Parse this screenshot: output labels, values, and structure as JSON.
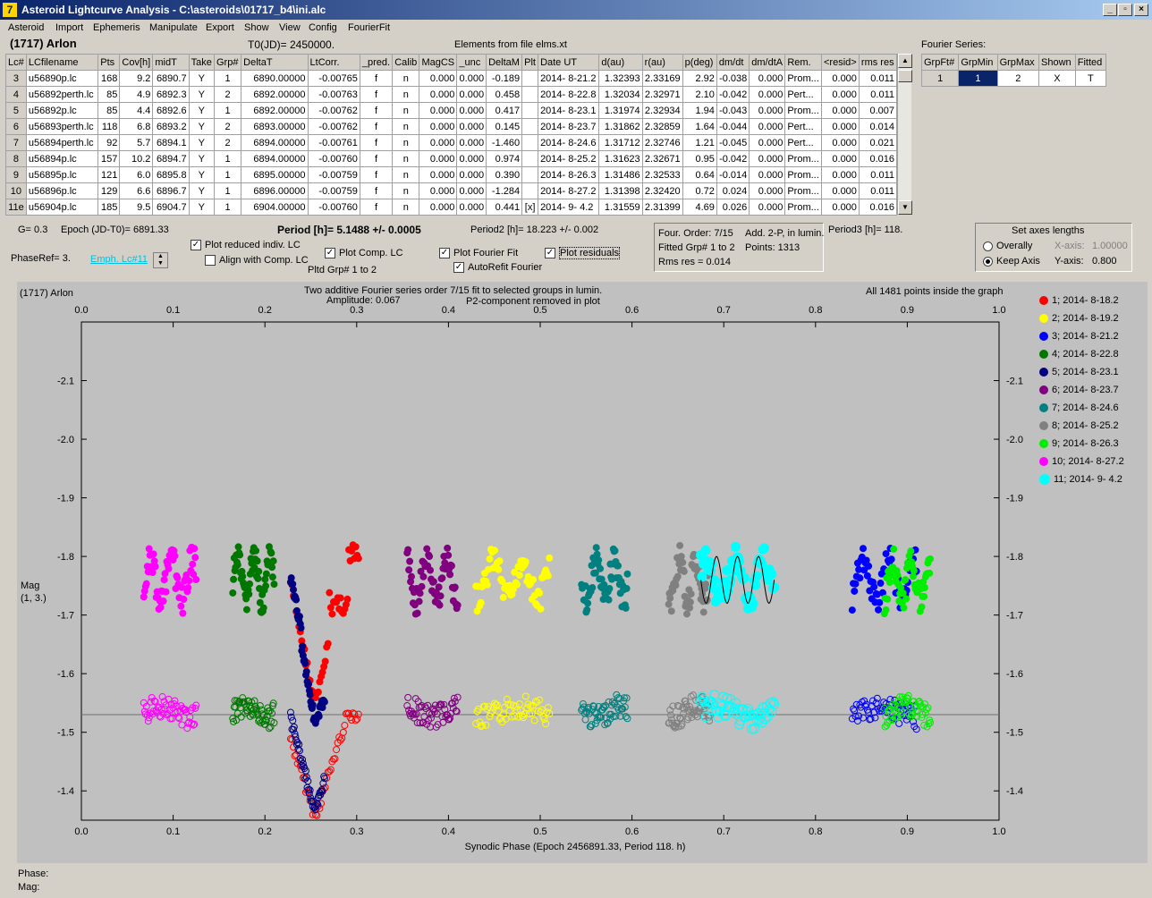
{
  "window": {
    "title": "Asteroid Lightcurve Analysis - C:\\asteroids\\01717_b4\\ini.alc",
    "app_icon_glyph": "7"
  },
  "menu": [
    "Asteroid",
    "Import",
    "Ephemeris",
    "Manipulate",
    "Export",
    "Show",
    "View",
    "Config",
    "FourierFit"
  ],
  "header": {
    "asteroid": "(1717) Arlon",
    "t0": "T0(JD)= 2450000.",
    "elements": "Elements from file elms.xt"
  },
  "table": {
    "columns": [
      "Lc#",
      "LCfilename",
      "Pts",
      "Cov[h]",
      "midT",
      "Take",
      "Grp#",
      "DeltaT",
      "LtCorr.",
      "_pred.",
      "Calib",
      "MagCS",
      "_unc",
      "DeltaM",
      "Plt",
      "Date UT",
      "d(au)",
      "r(au)",
      "p(deg)",
      "dm/dt",
      "dm/dtA",
      "Rem.",
      "<resid>",
      "rms res"
    ],
    "rows": [
      [
        "3",
        "u56890p.lc",
        "168",
        "9.2",
        "6890.7",
        "Y",
        "1",
        "6890.00000",
        "-0.00765",
        "f",
        "n",
        "0.000",
        "0.000",
        "-0.189",
        "",
        "2014- 8-21.2",
        "1.32393",
        "2.33169",
        "2.92",
        "-0.038",
        "0.000",
        "Prom...",
        "0.000",
        "0.011"
      ],
      [
        "4",
        "u56892perth.lc",
        "85",
        "4.9",
        "6892.3",
        "Y",
        "2",
        "6892.00000",
        "-0.00763",
        "f",
        "n",
        "0.000",
        "0.000",
        "0.458",
        "",
        "2014- 8-22.8",
        "1.32034",
        "2.32971",
        "2.10",
        "-0.042",
        "0.000",
        "Pert...",
        "0.000",
        "0.011"
      ],
      [
        "5",
        "u56892p.lc",
        "85",
        "4.4",
        "6892.6",
        "Y",
        "1",
        "6892.00000",
        "-0.00762",
        "f",
        "n",
        "0.000",
        "0.000",
        "0.417",
        "",
        "2014- 8-23.1",
        "1.31974",
        "2.32934",
        "1.94",
        "-0.043",
        "0.000",
        "Prom...",
        "0.000",
        "0.007"
      ],
      [
        "6",
        "u56893perth.lc",
        "118",
        "6.8",
        "6893.2",
        "Y",
        "2",
        "6893.00000",
        "-0.00762",
        "f",
        "n",
        "0.000",
        "0.000",
        "0.145",
        "",
        "2014- 8-23.7",
        "1.31862",
        "2.32859",
        "1.64",
        "-0.044",
        "0.000",
        "Pert...",
        "0.000",
        "0.014"
      ],
      [
        "7",
        "u56894perth.lc",
        "92",
        "5.7",
        "6894.1",
        "Y",
        "2",
        "6894.00000",
        "-0.00761",
        "f",
        "n",
        "0.000",
        "0.000",
        "-1.460",
        "",
        "2014- 8-24.6",
        "1.31712",
        "2.32746",
        "1.21",
        "-0.045",
        "0.000",
        "Pert...",
        "0.000",
        "0.021"
      ],
      [
        "8",
        "u56894p.lc",
        "157",
        "10.2",
        "6894.7",
        "Y",
        "1",
        "6894.00000",
        "-0.00760",
        "f",
        "n",
        "0.000",
        "0.000",
        "0.974",
        "",
        "2014- 8-25.2",
        "1.31623",
        "2.32671",
        "0.95",
        "-0.042",
        "0.000",
        "Prom...",
        "0.000",
        "0.016"
      ],
      [
        "9",
        "u56895p.lc",
        "121",
        "6.0",
        "6895.8",
        "Y",
        "1",
        "6895.00000",
        "-0.00759",
        "f",
        "n",
        "0.000",
        "0.000",
        "0.390",
        "",
        "2014- 8-26.3",
        "1.31486",
        "2.32533",
        "0.64",
        "-0.014",
        "0.000",
        "Prom...",
        "0.000",
        "0.011"
      ],
      [
        "10",
        "u56896p.lc",
        "129",
        "6.6",
        "6896.7",
        "Y",
        "1",
        "6896.00000",
        "-0.00759",
        "f",
        "n",
        "0.000",
        "0.000",
        "-1.284",
        "",
        "2014- 8-27.2",
        "1.31398",
        "2.32420",
        "0.72",
        "0.024",
        "0.000",
        "Prom...",
        "0.000",
        "0.011"
      ],
      [
        "11e",
        "u56904p.lc",
        "185",
        "9.5",
        "6904.7",
        "Y",
        "1",
        "6904.00000",
        "-0.00760",
        "f",
        "n",
        "0.000",
        "0.000",
        "0.441",
        "[x]",
        "2014- 9- 4.2",
        "1.31559",
        "2.31399",
        "4.69",
        "0.026",
        "0.000",
        "Prom...",
        "0.000",
        "0.016"
      ]
    ]
  },
  "fourier_series": {
    "label": "Fourier Series:",
    "columns": [
      "GrpFt#",
      "GrpMin",
      "GrpMax",
      "Shown",
      "Fitted"
    ],
    "row": [
      "1",
      "1",
      "2",
      "X",
      "T"
    ]
  },
  "info": {
    "g": "G= 0.3",
    "epoch": "Epoch (JD-T0)= 6891.33",
    "period": "Period [h]= 5.1488 +/- 0.0005",
    "period2": "Period2 [h]= 18.223 +/- 0.002",
    "period3": "Period3 [h]= 118.",
    "phaseref": "PhaseRef= 3.",
    "emph": "Emph. Lc#11",
    "fourier_box": [
      "Four. Order:  7/15",
      "Add. 2-P, in lumin.",
      "Fitted Grp# 1 to 2",
      "Points: 1313",
      "Rms res     = 0.014"
    ]
  },
  "checkboxes": {
    "plot_reduced": {
      "label": "Plot reduced indiv. LC",
      "checked": true
    },
    "align": {
      "label": "Align with Comp. LC",
      "checked": false
    },
    "plot_comp": {
      "label": "Plot Comp. LC",
      "checked": true
    },
    "plot_fourier": {
      "label": "Plot Fourier Fit",
      "checked": true
    },
    "autorefit": {
      "label": "AutoRefit Fourier",
      "checked": true
    },
    "plot_residuals": {
      "label": "Plot residuals",
      "checked": true
    }
  },
  "pltd_grp": "Pltd Grp#  1   to   2",
  "axes_panel": {
    "title": "Set axes lengths",
    "overall": "Overally",
    "keep": "Keep Axis",
    "xaxis_label": "X-axis:",
    "xaxis_value": "1.00000",
    "yaxis_label": "Y-axis:",
    "yaxis_value": "0.800"
  },
  "status": {
    "phase": "Phase:",
    "mag": "Mag:"
  },
  "chart_data": {
    "type": "scatter",
    "header_left": "(1717) Arlon",
    "header_center": [
      "Two additive Fourier series order 7/15 fit to selected groups in lumin.",
      "Amplitude: 0.067",
      "P2-component removed in plot"
    ],
    "header_right": "All 1481 points inside the graph",
    "xlabel": "Synodic Phase (Epoch 2456891.33, Period 118. h)",
    "ylabel": [
      "Mag",
      "(1, 3.)"
    ],
    "xlim": [
      0.0,
      1.0
    ],
    "ylim": [
      -2.2,
      -1.35
    ],
    "x_ticks": [
      "0.0",
      "0.1",
      "0.2",
      "0.3",
      "0.4",
      "0.5",
      "0.6",
      "0.7",
      "0.8",
      "0.9",
      "1.0"
    ],
    "y_ticks": [
      "-2.1",
      "-2.0",
      "-1.9",
      "-1.8",
      "-1.7",
      "-1.6",
      "-1.5",
      "-1.4"
    ],
    "y_tick_values": [
      -2.1,
      -2.0,
      -1.9,
      -1.8,
      -1.7,
      -1.6,
      -1.5,
      -1.4
    ],
    "residual_baseline": -1.53,
    "series": [
      {
        "name": "1; 2014- 8-18.2",
        "color": "#ff0000",
        "x_range": [
          0.228,
          0.302
        ],
        "shape": "dip_red"
      },
      {
        "name": "2; 2014- 8-19.2",
        "color": "#ffff00",
        "x_range": [
          0.43,
          0.51
        ],
        "shape": "wave"
      },
      {
        "name": "3; 2014- 8-21.2",
        "color": "#0000ff",
        "x_range": [
          0.84,
          0.91
        ],
        "shape": "wave"
      },
      {
        "name": "4; 2014- 8-22.8",
        "color": "#007800",
        "x_range": [
          0.165,
          0.21
        ],
        "shape": "wave"
      },
      {
        "name": "5; 2014- 8-23.1",
        "color": "#000080",
        "x_range": [
          0.228,
          0.265
        ],
        "shape": "dip_navy"
      },
      {
        "name": "6; 2014- 8-23.7",
        "color": "#800080",
        "x_range": [
          0.355,
          0.41
        ],
        "shape": "wave"
      },
      {
        "name": "7; 2014- 8-24.6",
        "color": "#008080",
        "x_range": [
          0.545,
          0.595
        ],
        "shape": "wave"
      },
      {
        "name": "8; 2014- 8-25.2",
        "color": "#808080",
        "x_range": [
          0.64,
          0.685
        ],
        "shape": "wave"
      },
      {
        "name": "9; 2014- 8-26.3",
        "color": "#00ee00",
        "x_range": [
          0.875,
          0.925
        ],
        "shape": "wave"
      },
      {
        "name": "10; 2014- 8-27.2",
        "color": "#ff00ff",
        "x_range": [
          0.068,
          0.125
        ],
        "shape": "wave"
      },
      {
        "name": "11; 2014- 9- 4.2",
        "color": "#00ffff",
        "x_range": [
          0.675,
          0.755
        ],
        "shape": "wave"
      }
    ]
  }
}
